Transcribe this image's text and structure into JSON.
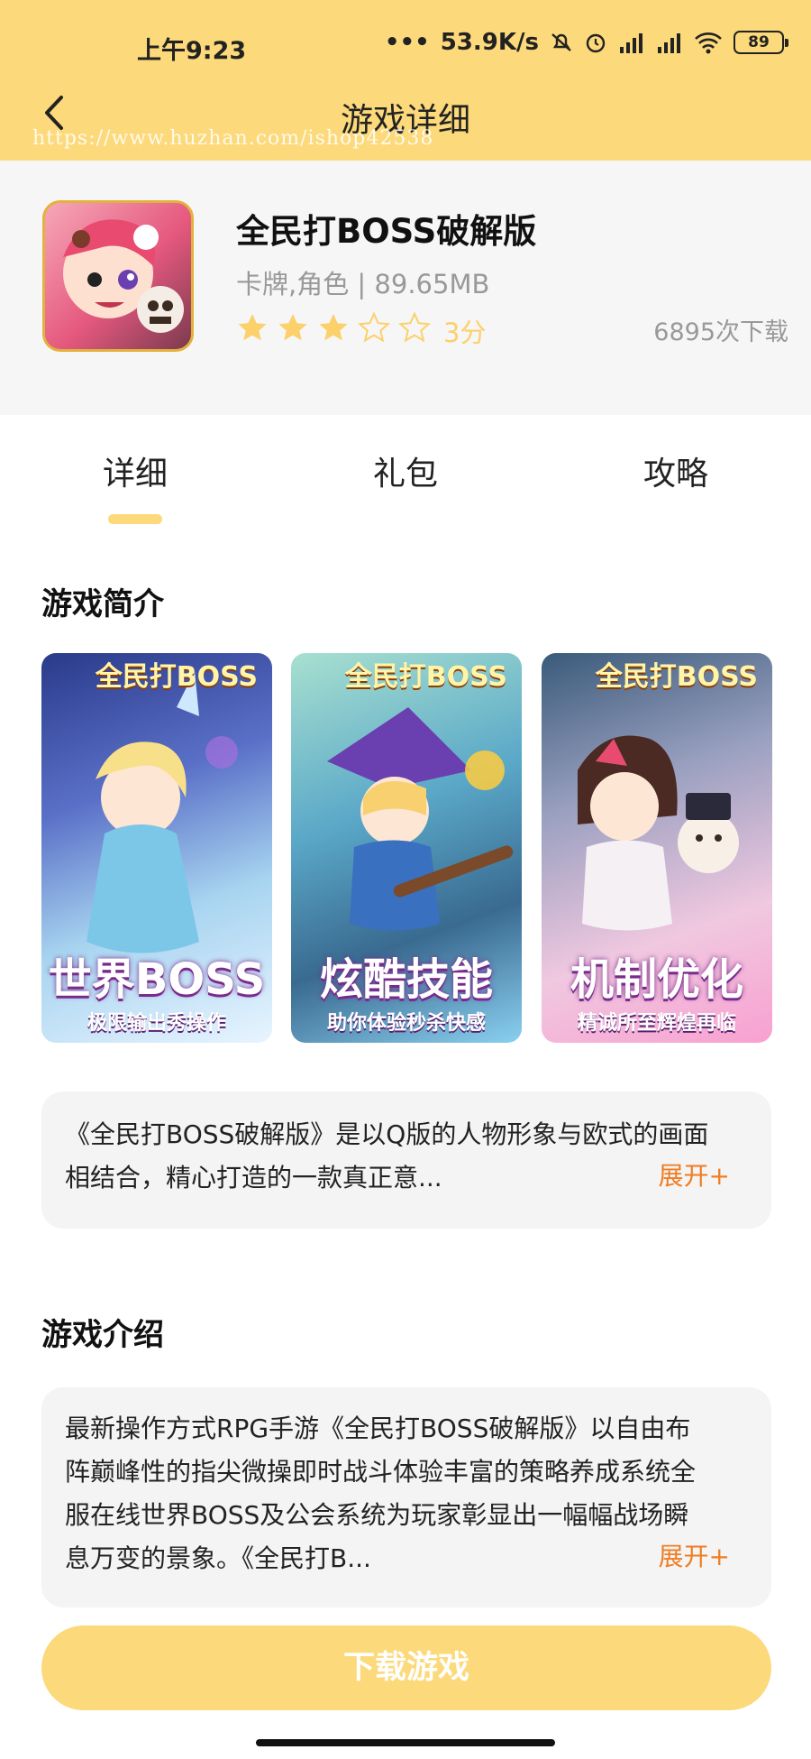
{
  "status_bar": {
    "time": "上午9:23",
    "speed": "53.9K/s",
    "battery": "89"
  },
  "header": {
    "title": "游戏详细",
    "watermark": "https://www.huzhan.com/ishop42538"
  },
  "app": {
    "name": "全民打BOSS破解版",
    "meta": "卡牌,角色 | 89.65MB",
    "rating": 3,
    "rating_max": 5,
    "score_label": "3分",
    "downloads": "6895次下载"
  },
  "tabs": [
    {
      "label": "详细",
      "active": true
    },
    {
      "label": "礼包",
      "active": false
    },
    {
      "label": "攻略",
      "active": false
    }
  ],
  "intro": {
    "title": "游戏简介",
    "screenshots": [
      {
        "logo": "全民打BOSS",
        "caption": "世界BOSS",
        "subcaption": "极限输出秀操作"
      },
      {
        "logo": "全民打BOSS",
        "caption": "炫酷技能",
        "subcaption": "助你体验秒杀快感"
      },
      {
        "logo": "全民打BOSS",
        "caption": "机制优化",
        "subcaption": "精诚所至辉煌再临"
      }
    ],
    "text_line1": "《全民打BOSS破解版》是以Q版的人物形象与欧式的画面",
    "text_line2": "相结合，精心打造的一款真正意...",
    "expand_label": "展开+"
  },
  "description": {
    "title": "游戏介绍",
    "text_line1": "最新操作方式RPG手游《全民打BOSS破解版》以自由布",
    "text_line2": "阵巅峰性的指尖微操即时战斗体验丰富的策略养成系统全",
    "text_line3": "服在线世界BOSS及公会系统为玩家彰显出一幅幅战场瞬",
    "text_line4": "息万变的景象。《全民打B...",
    "expand_label": "展开+"
  },
  "download_button": "下载游戏",
  "colors": {
    "accent": "#fcd97a",
    "expand": "#f07d22",
    "star_filled": "#fcd06a",
    "muted": "#999999"
  }
}
